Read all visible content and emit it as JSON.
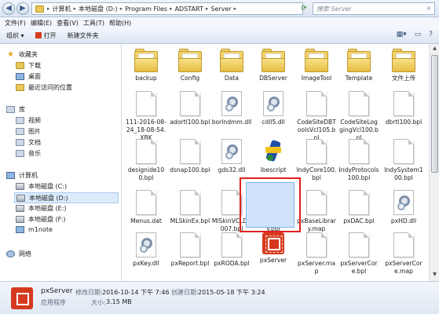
{
  "address": {
    "crumbs": [
      "计算机",
      "本地磁盘 (D:)",
      "Program Files",
      "ADSTART",
      "Server"
    ]
  },
  "search": {
    "placeholder": "搜索 Server"
  },
  "menu": [
    "文件(F)",
    "编辑(E)",
    "查看(V)",
    "工具(T)",
    "帮助(H)"
  ],
  "toolbar": {
    "organize": "组织 ▾",
    "open": "打开",
    "new_folder": "新建文件夹"
  },
  "nav": {
    "favorites": "收藏夹",
    "downloads": "下载",
    "desktop": "桌面",
    "recent": "最近访问的位置",
    "libraries": "库",
    "video": "视频",
    "pictures": "图片",
    "documents": "文档",
    "music": "音乐",
    "computer": "计算机",
    "drive_c": "本地磁盘 (C:)",
    "drive_d": "本地磁盘 (D:)",
    "drive_e": "本地磁盘 (E:)",
    "drive_f": "本地磁盘 (F:)",
    "m1note": "m1note",
    "network": "网络"
  },
  "files": [
    {
      "name": "backup",
      "icon": "folder"
    },
    {
      "name": "Config",
      "icon": "folder"
    },
    {
      "name": "Data",
      "icon": "folder"
    },
    {
      "name": "DBServer",
      "icon": "folder"
    },
    {
      "name": "ImageTool",
      "icon": "folder"
    },
    {
      "name": "Template",
      "icon": "folder"
    },
    {
      "name": "文件上传",
      "icon": "folder"
    },
    {
      "name": "111-2016-08-24_18-08-54.XBK",
      "icon": "document"
    },
    {
      "name": "adortl100.bpl",
      "icon": "document"
    },
    {
      "name": "borlndmm.dll",
      "icon": "dll"
    },
    {
      "name": "cdll5.dll",
      "icon": "dll"
    },
    {
      "name": "CodeSiteDBToolsVcl105.bpl",
      "icon": "document"
    },
    {
      "name": "CodeSiteLoggingVcl100.bpl",
      "icon": "document"
    },
    {
      "name": "dbrtl100.bpl",
      "icon": "document"
    },
    {
      "name": "designide100.bpl",
      "icon": "document"
    },
    {
      "name": "dsnap100.bpl",
      "icon": "document"
    },
    {
      "name": "gds32.dll",
      "icon": "dll"
    },
    {
      "name": "ibescript",
      "icon": "ibescript"
    },
    {
      "name": "IndyCore100.bpl",
      "icon": "document"
    },
    {
      "name": "IndyProtocols100.bpl",
      "icon": "document"
    },
    {
      "name": "IndySystem100.bpl",
      "icon": "document"
    },
    {
      "name": "Menus.dat",
      "icon": "document"
    },
    {
      "name": "MLSkinEx.bpl",
      "icon": "document"
    },
    {
      "name": "MlSkinVCLD2007.bpl",
      "icon": "document"
    },
    {
      "name": "pxBaseLibrary.bpl",
      "icon": "document"
    },
    {
      "name": "pxBaseLibrary.map",
      "icon": "document"
    },
    {
      "name": "pxDAC.bpl",
      "icon": "document"
    },
    {
      "name": "pxHD.dll",
      "icon": "dll"
    },
    {
      "name": "pxKey.dll",
      "icon": "dll"
    },
    {
      "name": "pxReport.bpl",
      "icon": "document"
    },
    {
      "name": "pxRODA.bpl",
      "icon": "document"
    },
    {
      "name": "pxServer",
      "icon": "app"
    },
    {
      "name": "pxServer.map",
      "icon": "document"
    },
    {
      "name": "pxServerCore.bpl",
      "icon": "document"
    },
    {
      "name": "pxServerCore.map",
      "icon": "document"
    }
  ],
  "details": {
    "name": "pxServer",
    "modified_label": "修改日期:",
    "modified": "2016-10-14 下午 7:46",
    "created_label": "创建日期:",
    "created": "2015-05-18 下午 3:24",
    "type": "应用程序",
    "size_label": "大小:",
    "size": "3.15 MB"
  }
}
